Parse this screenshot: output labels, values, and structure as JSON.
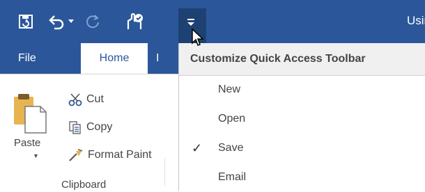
{
  "window": {
    "title": "Usin"
  },
  "qat": {
    "icons": [
      "save-icon",
      "undo-icon",
      "undo-dropdown-icon",
      "redo-icon",
      "touch-mode-icon",
      "customize-dropdown-icon"
    ]
  },
  "tabs": [
    {
      "label": "File"
    },
    {
      "label": "Home",
      "active": true
    },
    {
      "label": "I"
    }
  ],
  "ribbon": {
    "clipboard": {
      "paste_label": "Paste",
      "cut_label": "Cut",
      "copy_label": "Copy",
      "format_painter_label": "Format Paint",
      "group_label": "Clipboard"
    }
  },
  "menu": {
    "header": "Customize Quick Access Toolbar",
    "items": [
      {
        "label": "New",
        "checked": false
      },
      {
        "label": "Open",
        "checked": false
      },
      {
        "label": "Save",
        "checked": true
      },
      {
        "label": "Email",
        "checked": false
      }
    ],
    "check_glyph": "✓"
  },
  "colors": {
    "accent": "#2b579a",
    "accent_dark": "#1e4173",
    "menu_header_bg": "#f0f0f0"
  }
}
